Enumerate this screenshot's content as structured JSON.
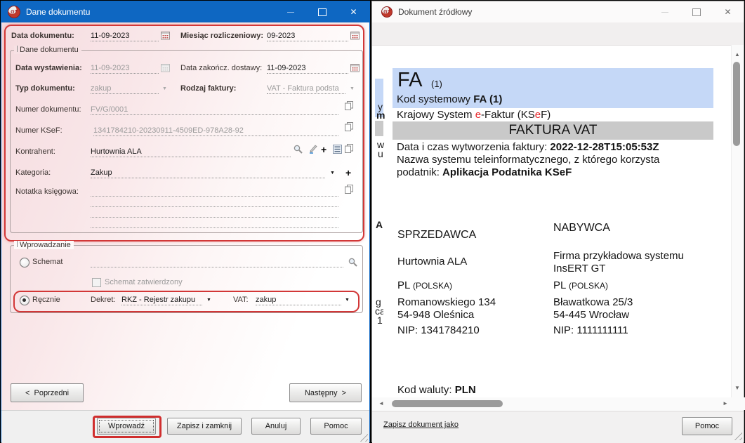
{
  "colors": {
    "titlebar_blue": "#0e67c2",
    "highlight_red": "#d23737",
    "form_pink": "#f5dbdf",
    "invoice_band_blue": "#c5d8f7",
    "invoice_band_gray": "#c9c9c9",
    "ksef_red": "#e8262a"
  },
  "icons": {
    "logo_text": "GT",
    "close_glyph": "✕",
    "dropdown_glyph": "▼",
    "plus_glyph": "+",
    "scroll_up_glyph": "▲",
    "scroll_down_glyph": "▼",
    "scroll_left_glyph": "◄",
    "scroll_right_glyph": "►"
  },
  "left_window": {
    "title": "Dane dokumentu",
    "top_row": {
      "doc_date_label": "Data dokumentu:",
      "doc_date_value": "11-09-2023",
      "month_label": "Miesiąc rozliczeniowy:",
      "month_value": "09-2023"
    },
    "group_dane": {
      "title": "Dane dokumentu",
      "issue_date_label": "Data wystawienia:",
      "issue_date_value": "11-09-2023",
      "delivery_date_label": "Data zakończ. dostawy:",
      "delivery_date_value": "11-09-2023",
      "doc_type_label": "Typ dokumentu:",
      "doc_type_value": "zakup",
      "invoice_kind_label": "Rodzaj faktury:",
      "invoice_kind_value": "VAT - Faktura podsta",
      "doc_number_label": "Numer dokumentu:",
      "doc_number_value": "FV/G/0001",
      "ksef_number_label": "Numer KSeF:",
      "ksef_number_value": "1341784210-20230911-4509ED-978A28-92",
      "contractor_label": "Kontrahent:",
      "contractor_value": "Hurtownia ALA",
      "category_label": "Kategoria:",
      "category_value": "Zakup",
      "note_label": "Notatka księgowa:"
    },
    "group_wprowadzanie": {
      "title": "Wprowadzanie",
      "schema_option_label": "Schemat",
      "schema_approved_label": "Schemat zatwierdzony",
      "manual_option_label": "Ręcznie",
      "dekret_label": "Dekret:",
      "dekret_value": "RKZ - Rejestr zakupu",
      "vat_label": "VAT:",
      "vat_value": "zakup"
    },
    "nav_buttons": {
      "prev_label": "<  Poprzedni",
      "next_label": "Następny  >"
    },
    "footer_buttons": {
      "enter_label": "Wprowadź",
      "save_close_label": "Zapisz i zamknij",
      "cancel_label": "Anuluj",
      "help_label": "Pomoc"
    }
  },
  "right_window": {
    "title": "Dokument źródłowy",
    "invoice": {
      "fa_code": "FA",
      "fa_variant": "(1)",
      "system_code_prefix": "Kod systemowy ",
      "system_code_bold": "FA (1)",
      "ksef_line": {
        "part1": "Krajowy System ",
        "red1": "e",
        "part2": "-Faktur (KS",
        "red2": "e",
        "part3": "F)"
      },
      "doc_title": "FAKTURA VAT",
      "created_label": "Data i czas wytworzenia faktury: ",
      "created_value": "2022-12-28T15:05:53Z",
      "system_name_line1": "Nazwa systemu teleinformatycznego, z którego korzysta",
      "system_name_prefix": "podatnik: ",
      "system_name_bold": "Aplikacja Podatnika KSeF",
      "seller_header": "SPRZEDAWCA",
      "buyer_header": "NABYWCA",
      "seller": {
        "name": "Hurtownia ALA",
        "country_code": "PL",
        "country_name": "(POLSKA)",
        "street": "Romanowskiego 134",
        "city": "54-948 Oleśnica",
        "nip": "NIP: 1341784210"
      },
      "buyer": {
        "name_line1": "Firma przykładowa systemu",
        "name_line2": "InsERT GT",
        "country_code": "PL",
        "country_name": "(POLSKA)",
        "street": "Bławatkowa 25/3",
        "city": "54-445 Wrocław",
        "nip": "NIP: 1111111111"
      },
      "currency_label": "Kod waluty: ",
      "currency_value": "PLN",
      "edge_fragments": [
        "y",
        "m",
        "w",
        "u",
        "A",
        "g",
        "ca",
        "1"
      ]
    },
    "footer": {
      "save_as_label": "Zapisz dokument jako",
      "help_label": "Pomoc"
    }
  }
}
